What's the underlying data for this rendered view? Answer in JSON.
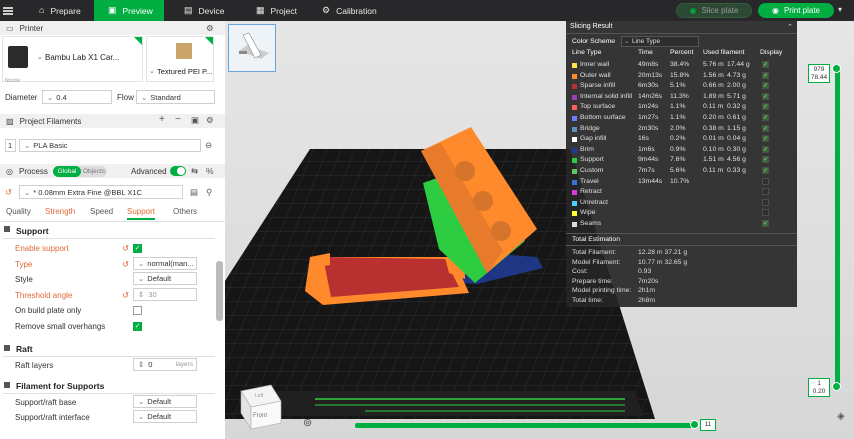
{
  "topbar": {
    "tabs": [
      {
        "label": "Prepare",
        "icon": "home-icon"
      },
      {
        "label": "Preview",
        "icon": "preview-icon",
        "active": true
      },
      {
        "label": "Device",
        "icon": "device-icon"
      },
      {
        "label": "Project",
        "icon": "project-icon"
      },
      {
        "label": "Calibration",
        "icon": "calibration-icon"
      }
    ],
    "slice_plate": "Slice plate",
    "print_plate": "Print plate"
  },
  "printer": {
    "section": "Printer",
    "name": "Bambu Lab X1 Car...",
    "nozzle_label": "Nozzle",
    "plate": "Textured PEI P...",
    "diameter_label": "Diameter",
    "diameter_value": "0.4",
    "flow_label": "Flow",
    "flow_value": "Standard"
  },
  "filaments": {
    "section": "Project Filaments",
    "slot": "1",
    "name": "PLA Basic"
  },
  "process": {
    "section": "Process",
    "global": "Global",
    "objects": "Objects",
    "advanced": "Advanced",
    "preset": "* 0.08mm Extra Fine @BBL X1C",
    "tabs": [
      "Quality",
      "Strength",
      "Speed",
      "Support",
      "Others"
    ],
    "active_tab": "Support"
  },
  "support": {
    "title": "Support",
    "enable_support": "Enable support",
    "type_label": "Type",
    "type_value": "normal(man...",
    "style_label": "Style",
    "style_value": "Default",
    "threshold_label": "Threshold angle",
    "threshold_value": "30",
    "build_plate_only": "On build plate only",
    "remove_small": "Remove small overhangs"
  },
  "raft": {
    "title": "Raft",
    "layers_label": "Raft layers",
    "layers_value": "0",
    "layers_unit": "layers"
  },
  "filament_supports": {
    "title": "Filament for Supports",
    "base_label": "Support/raft base",
    "base_value": "Default",
    "interface_label": "Support/raft interface",
    "interface_value": "Default"
  },
  "slicing_result": {
    "title": "Slicing Result",
    "color_scheme_label": "Color Scheme",
    "color_scheme_value": "Line Type",
    "headers": [
      "Line Type",
      "Time",
      "Percent",
      "Used filament",
      "Display"
    ],
    "rows": [
      {
        "name": "Inner wall",
        "time": "49m8s",
        "percent": "38.4%",
        "length": "5.76 m",
        "weight": "17.44 g",
        "color": "#ffe24d",
        "display": true
      },
      {
        "name": "Outer wall",
        "time": "20m13s",
        "percent": "15.8%",
        "length": "1.56 m",
        "weight": "4.73 g",
        "color": "#ff8a2b",
        "display": true
      },
      {
        "name": "Sparse infill",
        "time": "6m30s",
        "percent": "5.1%",
        "length": "0.66 m",
        "weight": "2.00 g",
        "color": "#b8302f",
        "display": true
      },
      {
        "name": "Internal solid infill",
        "time": "14m26s",
        "percent": "11.3%",
        "length": "1.89 m",
        "weight": "5.71 g",
        "color": "#9b3fb5",
        "display": true
      },
      {
        "name": "Top surface",
        "time": "1m24s",
        "percent": "1.1%",
        "length": "0.11 m",
        "weight": "0.32 g",
        "color": "#ff5c5c",
        "display": true
      },
      {
        "name": "Bottom surface",
        "time": "1m27s",
        "percent": "1.1%",
        "length": "0.20 m",
        "weight": "0.61 g",
        "color": "#6c7bff",
        "display": true
      },
      {
        "name": "Bridge",
        "time": "2m30s",
        "percent": "2.0%",
        "length": "0.38 m",
        "weight": "1.15 g",
        "color": "#5b8fbf",
        "display": true
      },
      {
        "name": "Gap infill",
        "time": "16s",
        "percent": "0.2%",
        "length": "0.01 m",
        "weight": "0.04 g",
        "color": "#ffffff",
        "display": true
      },
      {
        "name": "Brim",
        "time": "1m6s",
        "percent": "0.9%",
        "length": "0.10 m",
        "weight": "0.30 g",
        "color": "#1f3a8f",
        "display": true
      },
      {
        "name": "Support",
        "time": "9m44s",
        "percent": "7.6%",
        "length": "1.51 m",
        "weight": "4.56 g",
        "color": "#2ecc40",
        "display": true
      },
      {
        "name": "Custom",
        "time": "7m7s",
        "percent": "5.6%",
        "length": "0.11 m",
        "weight": "0.33 g",
        "color": "#5fc85f",
        "display": true
      },
      {
        "name": "Travel",
        "time": "13m44s",
        "percent": "10.7%",
        "length": "",
        "weight": "",
        "color": "#3b6fd4",
        "display": false
      },
      {
        "name": "Retract",
        "time": "",
        "percent": "",
        "length": "",
        "weight": "",
        "color": "#d63ad6",
        "display": false
      },
      {
        "name": "Unretract",
        "time": "",
        "percent": "",
        "length": "",
        "weight": "",
        "color": "#4dd0ff",
        "display": false
      },
      {
        "name": "Wipe",
        "time": "",
        "percent": "",
        "length": "",
        "weight": "",
        "color": "#ffff33",
        "display": false
      },
      {
        "name": "Seams",
        "time": "",
        "percent": "",
        "length": "",
        "weight": "",
        "color": "#dddddd",
        "display": true
      }
    ],
    "total_title": "Total Estimation",
    "totals": [
      {
        "label": "Total Filament:",
        "value": "12.28 m    37.21 g"
      },
      {
        "label": "Model Filament:",
        "value": "10.77 m    32.65 g"
      },
      {
        "label": "Cost:",
        "value": "0.93"
      },
      {
        "label": "Prepare time:",
        "value": "7m20s"
      },
      {
        "label": "Model printing time:",
        "value": "2h1m"
      },
      {
        "label": "Total time:",
        "value": "2h8m"
      }
    ]
  },
  "layer_slider": {
    "top_layer": "979",
    "top_height": "78.44",
    "bottom_layer": "1",
    "bottom_height": "0.20"
  },
  "move_slider": {
    "value": "11"
  },
  "view_cube": {
    "front": "Front",
    "left": "Left"
  }
}
